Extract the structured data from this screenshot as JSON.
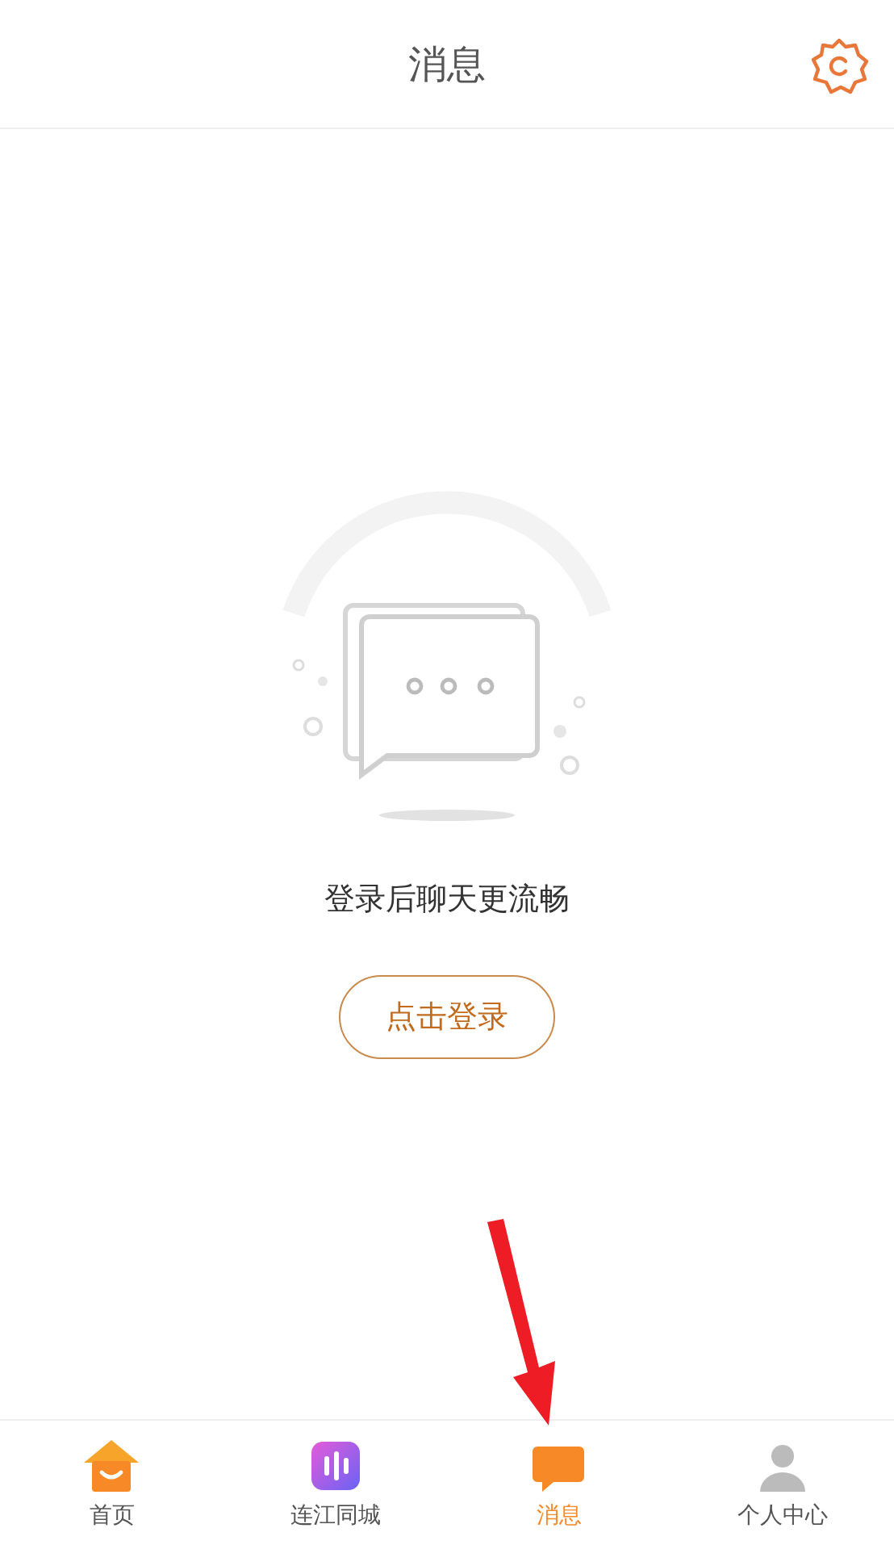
{
  "header": {
    "title": "消息"
  },
  "empty_state": {
    "message": "登录后聊天更流畅",
    "button": "点击登录"
  },
  "tabs": [
    {
      "label": "首页",
      "kind": "home",
      "selected": false
    },
    {
      "label": "连江同城",
      "kind": "city",
      "selected": false
    },
    {
      "label": "消息",
      "kind": "message",
      "selected": true
    },
    {
      "label": "个人中心",
      "kind": "profile",
      "selected": false
    }
  ]
}
